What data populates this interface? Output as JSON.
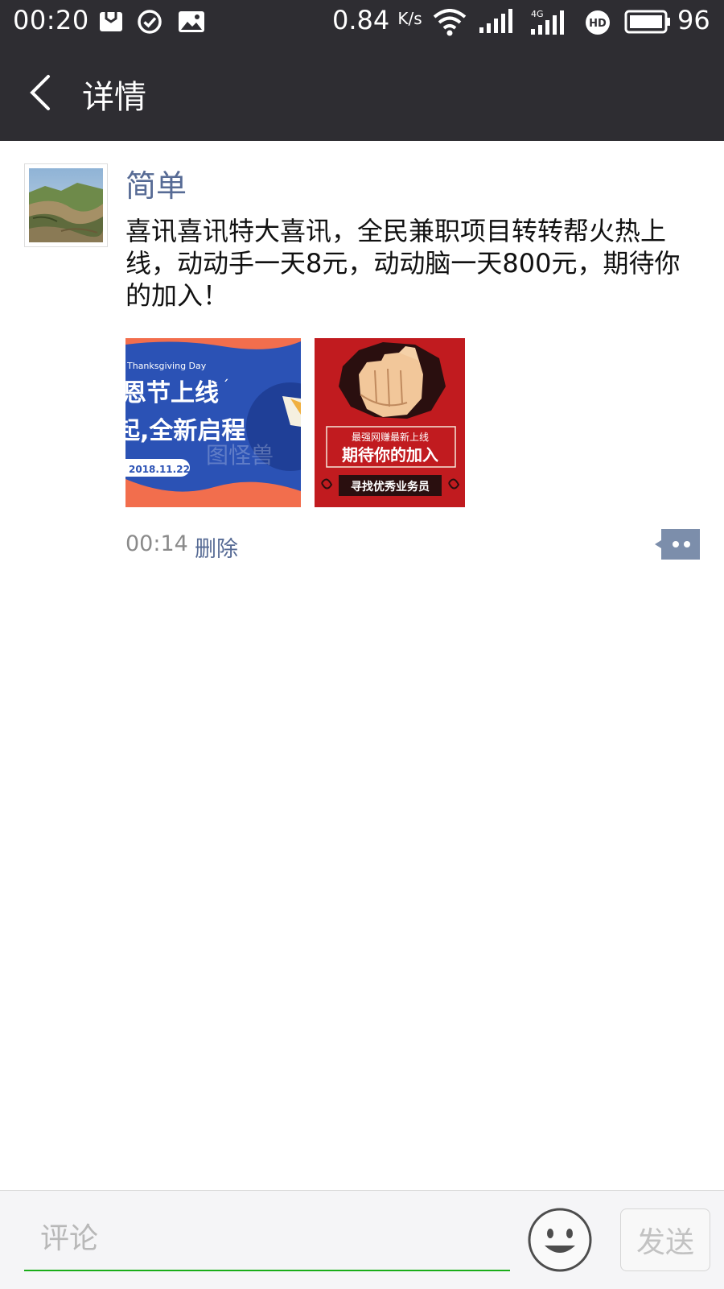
{
  "status_bar": {
    "time": "00:20",
    "speed": "0.84",
    "speed_unit": "K/s",
    "network_label": "4G",
    "battery": "96",
    "icons": [
      "mail-icon",
      "check-circle-icon",
      "image-icon",
      "wifi-icon",
      "signal-icon",
      "signal-4g-icon",
      "hd-icon",
      "battery-icon"
    ]
  },
  "header": {
    "title": "详情"
  },
  "post": {
    "author": "简单",
    "text": "喜讯喜讯特大喜讯，全民兼职项目转转帮火热上线，动动手一天8元，动动脑一天800元，期待你的加入！",
    "images": [
      {
        "caption_en": "Thanksgiving Day",
        "line1": "恩节上线",
        "line2": "起,全新启程",
        "date": "2018.11.22",
        "watermark": "图怪兽"
      },
      {
        "top_line": "最强网赚最新上线",
        "main_line": "期待你的加入",
        "bottom_line": "寻找优秀业务员"
      }
    ],
    "time": "00:14",
    "delete_label": "删除"
  },
  "composer": {
    "placeholder": "评论",
    "send_label": "发送"
  },
  "colors": {
    "topbar": "#2e2d32",
    "link": "#576b95",
    "accent_green": "#1aad19"
  }
}
